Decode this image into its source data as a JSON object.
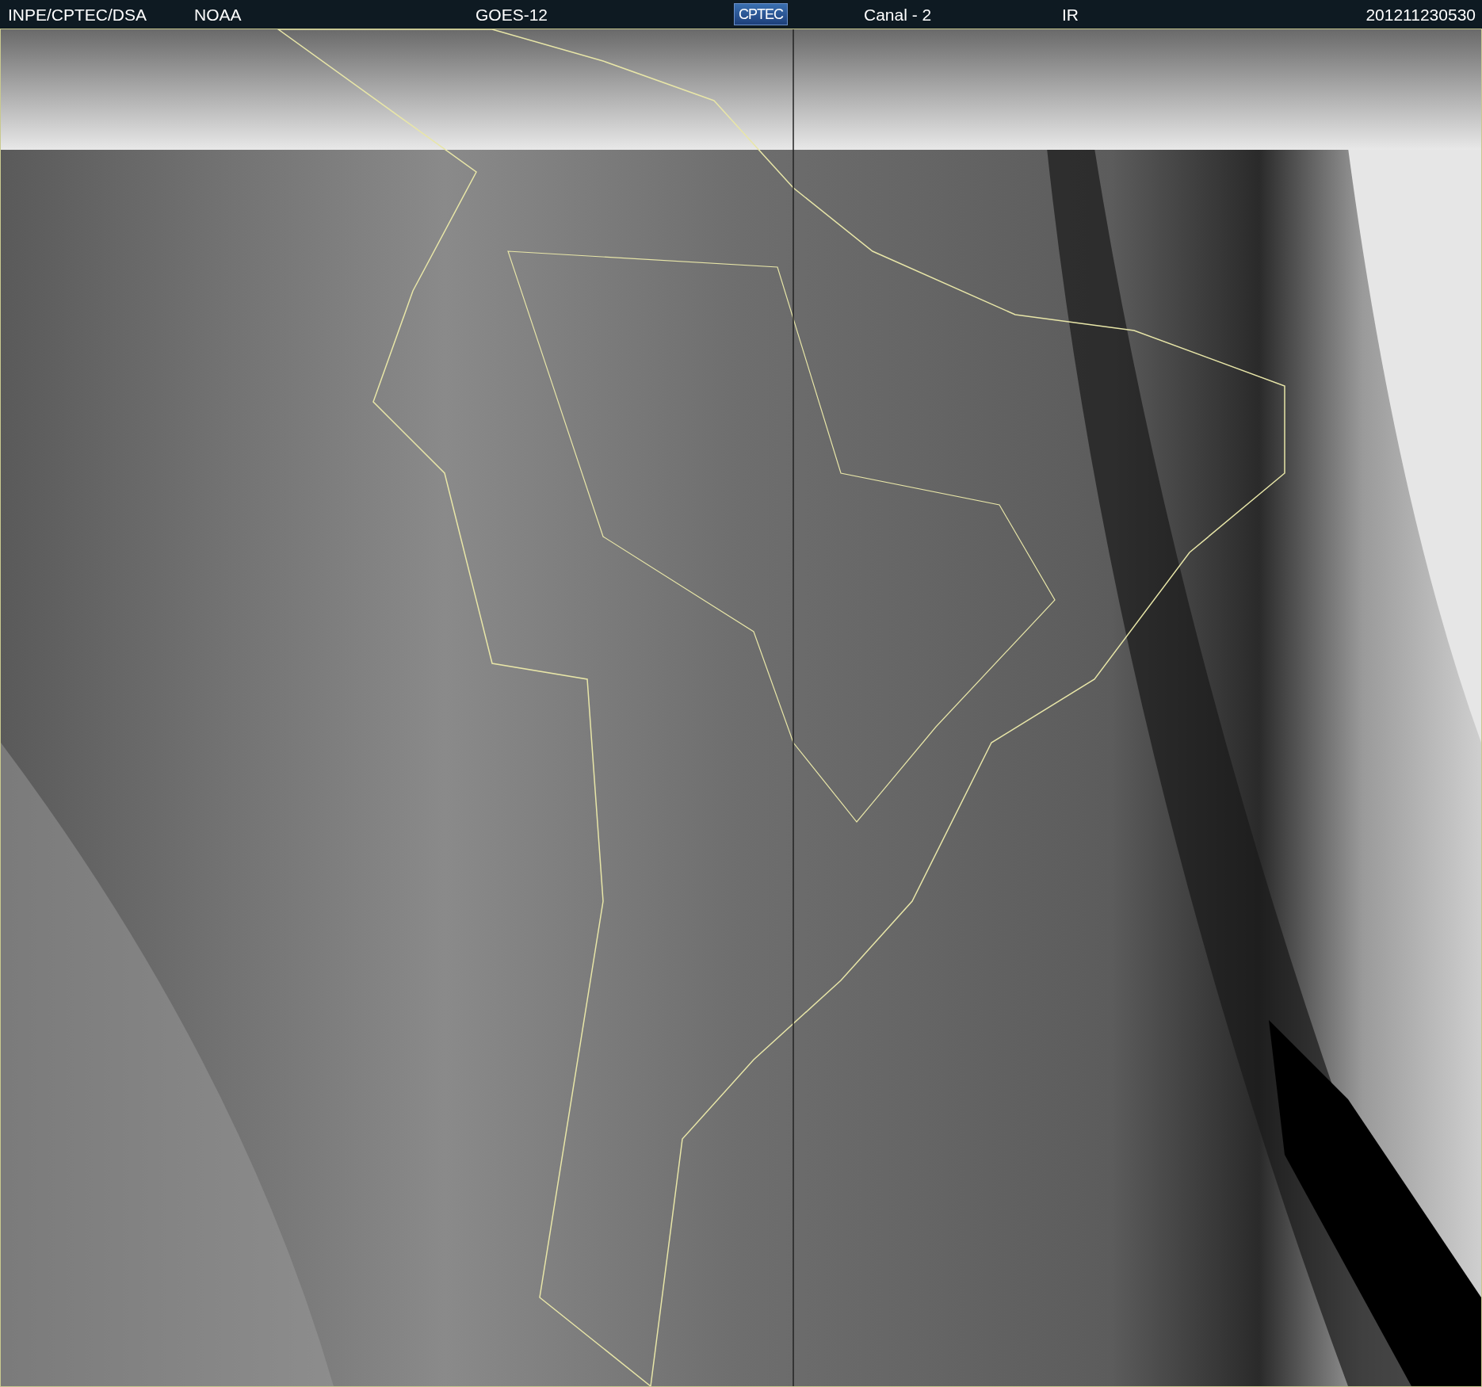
{
  "header": {
    "source": "INPE/CPTEC/DSA",
    "agency": "NOAA",
    "satellite": "GOES-12",
    "logo": "CPTEC",
    "channel": "Canal - 2",
    "band": "IR",
    "timestamp": "201211230530"
  }
}
